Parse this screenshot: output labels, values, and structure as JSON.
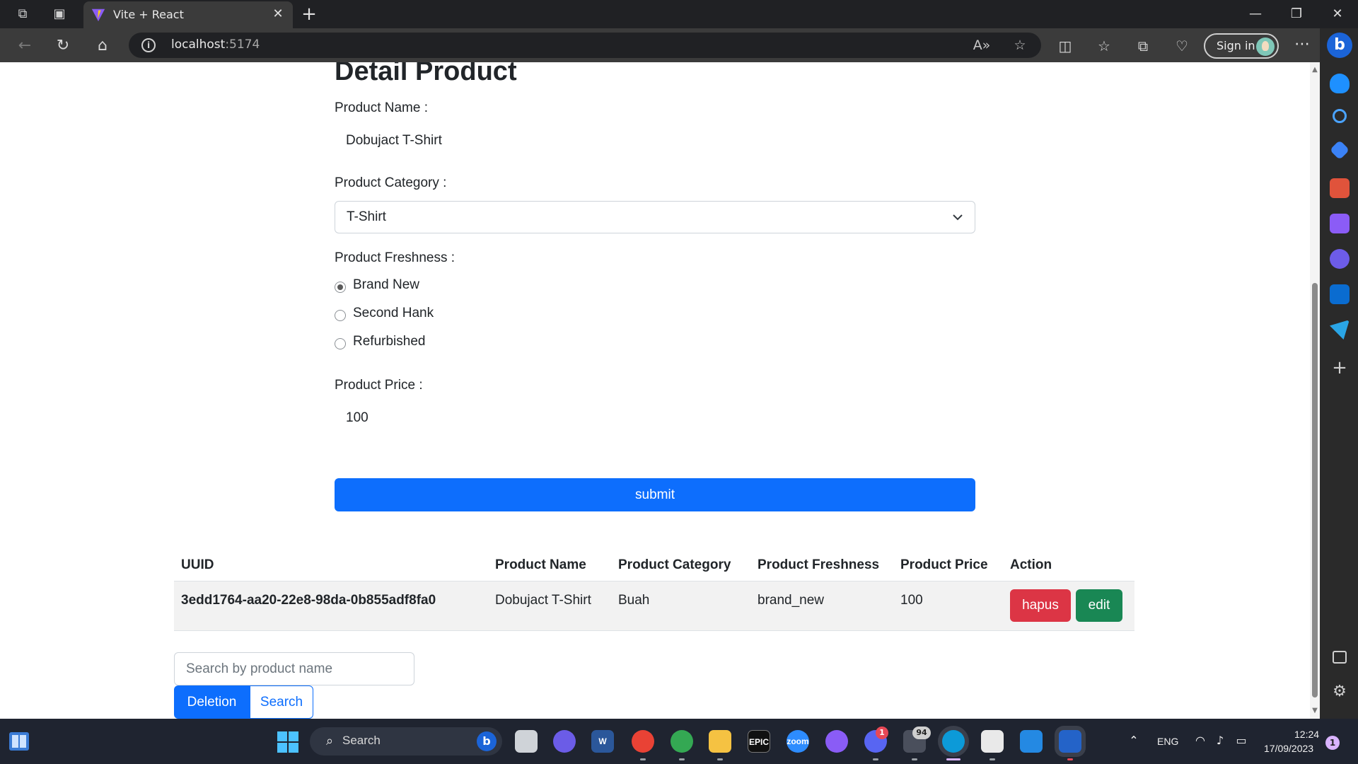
{
  "browser": {
    "tab_title": "Vite + React",
    "url_host": "localhost",
    "url_port": ":5174",
    "signin_label": "Sign in"
  },
  "form": {
    "title": "Detail Product",
    "product_name_label": "Product Name :",
    "product_name_value": "Dobujact T-Shirt",
    "product_category_label": "Product Category :",
    "product_category_value": "T-Shirt",
    "product_freshness_label": "Product Freshness :",
    "freshness_options": [
      {
        "label": "Brand New",
        "checked": true
      },
      {
        "label": "Second Hank",
        "checked": false
      },
      {
        "label": "Refurbished",
        "checked": false
      }
    ],
    "product_price_label": "Product Price :",
    "product_price_value": "100",
    "submit_label": "submit"
  },
  "table": {
    "headers": [
      "UUID",
      "Product Name",
      "Product Category",
      "Product Freshness",
      "Product Price",
      "Action"
    ],
    "rows": [
      {
        "uuid": "3edd1764-aa20-22e8-98da-0b855adf8fa0",
        "name": "Dobujact T-Shirt",
        "category": "Buah",
        "freshness": "brand_new",
        "price": "100",
        "delete_label": "hapus",
        "edit_label": "edit"
      }
    ]
  },
  "search": {
    "placeholder": "Search by product name",
    "deletion_label": "Deletion",
    "search_label": "Search"
  },
  "taskbar": {
    "search_label": "Search",
    "discord_badge": "1",
    "app_badge": "94",
    "language": "ENG",
    "time": "12:24",
    "date": "17/09/2023",
    "notification_count": "1"
  },
  "colors": {
    "primary": "#0d6efd",
    "danger": "#dc3545",
    "success": "#198754",
    "text": "#212529"
  }
}
